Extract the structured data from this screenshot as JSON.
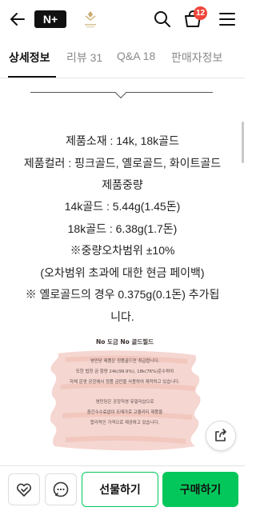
{
  "header": {
    "store_badge": "N+",
    "cart_count": "12"
  },
  "tabs": [
    {
      "label": "상세정보"
    },
    {
      "label": "리뷰 31"
    },
    {
      "label": "Q&A 18"
    },
    {
      "label": "판매자정보"
    }
  ],
  "spec": {
    "material": "제품소재 : 14k, 18k골드",
    "color": "제품컬러 : 핑크골드, 옐로골드, 화이트골드",
    "weight_title": "제품중량",
    "weight_14k": "14k골드 : 5.44g(1.45돈)",
    "weight_18k": "18k골드 : 6.38g(1.7돈)",
    "tolerance": "※중량오차범위 ±10%",
    "refund": "(오차범위 초과에 대한 현금 페이백)",
    "yellow_note_1": "※ 옐로골드의 경우 0.375g(0.1돈) 추가됩",
    "yellow_note_2": "니다."
  },
  "banner": {
    "title": "No 도금 No 골드필드",
    "line1": "영민당 제품은 정품골드만 취급합니다.",
    "line2": "또한 법정 금 함량 24k(99.9%), 18k(76%)준수하여",
    "line3": "자체 운영 공장에서 정품 금만을 사용하여 제작하고 있습니다.",
    "line4": "영민당은 공장직영 유얼리샵으로",
    "line5": "중간수수료없이 도매가로 고퀄리티 제품을",
    "line6": "합리적인 가격으로 제공하고 있습니다."
  },
  "bottom": {
    "gift_label": "선물하기",
    "buy_label": "구매하기"
  },
  "colors": {
    "accent": "#03c75a",
    "badge": "#f0463b",
    "text": "#222222"
  },
  "icons": [
    "back-arrow-icon",
    "brand-logo-icon",
    "search-icon",
    "cart-icon",
    "menu-icon",
    "share-icon",
    "heart-check-icon",
    "chat-icon"
  ]
}
